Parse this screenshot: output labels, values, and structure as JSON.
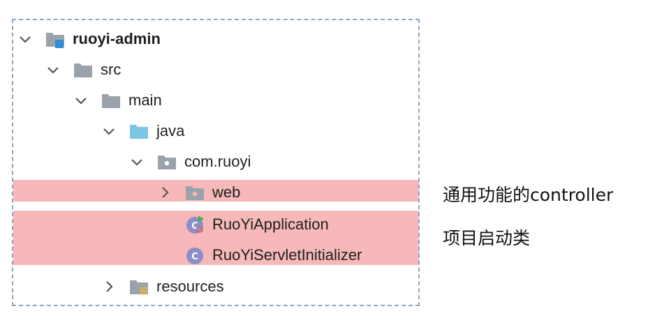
{
  "tree": {
    "nodes": [
      {
        "label": "ruoyi-admin",
        "icon": "module-folder-icon",
        "expanded": true
      },
      {
        "label": "src",
        "icon": "folder-icon",
        "expanded": true
      },
      {
        "label": "main",
        "icon": "folder-icon",
        "expanded": true
      },
      {
        "label": "java",
        "icon": "source-root-folder-icon",
        "expanded": true
      },
      {
        "label": "com.ruoyi",
        "icon": "package-icon",
        "expanded": true
      },
      {
        "label": "web",
        "icon": "package-icon",
        "expanded": false
      },
      {
        "label": "RuoYiApplication",
        "icon": "runnable-class-icon"
      },
      {
        "label": "RuoYiServletInitializer",
        "icon": "class-icon"
      },
      {
        "label": "resources",
        "icon": "resources-folder-icon",
        "expanded": false
      }
    ]
  },
  "annotations": {
    "web": "通用功能的controller",
    "startup": "项目启动类"
  },
  "colors": {
    "highlight": "#f6b8b8",
    "folder": "#9aa3ab",
    "source_root": "#7cc5e6",
    "class_badge": "#8b8fc7",
    "run_badge": "#4caf50",
    "border": "#8fa7c0"
  }
}
